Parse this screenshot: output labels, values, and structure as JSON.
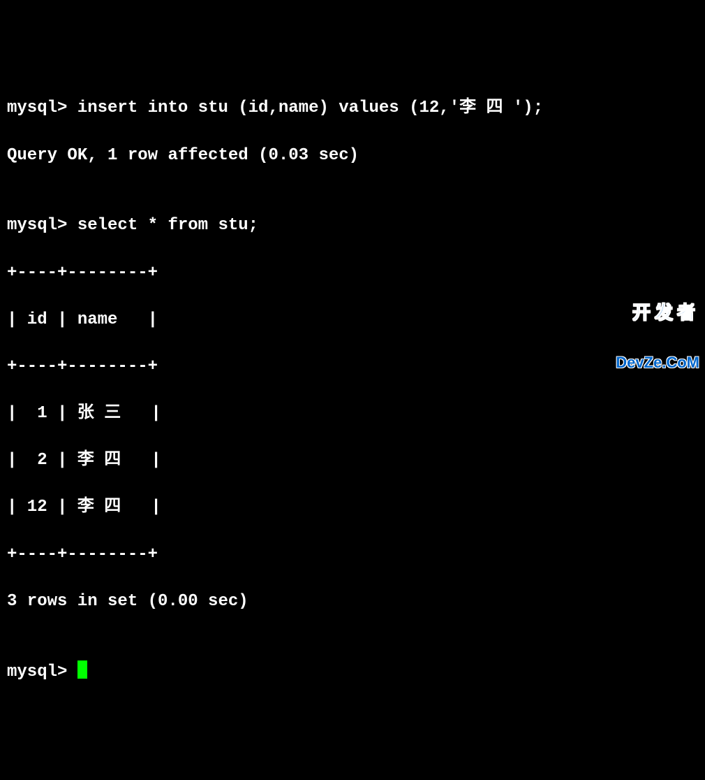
{
  "lines": {
    "l1": "mysql> insert into stu (id,name) values (12,'李 四 ');",
    "l2": "Query OK, 1 row affected (0.03 sec)",
    "l3": "",
    "l4": "mysql> select * from stu;",
    "l5": "+----+--------+",
    "l6": "| id | name   |",
    "l7": "+----+--------+",
    "l8": "|  1 | 张 三   |",
    "l9": "|  2 | 李 四   |",
    "l10": "| 12 | 李 四   |",
    "l11": "+----+--------+",
    "l12": "3 rows in set (0.00 sec)",
    "l13": "",
    "l14": "mysql> "
  },
  "watermark": {
    "top": "开发者",
    "bottom": "DevZe.CoM"
  }
}
